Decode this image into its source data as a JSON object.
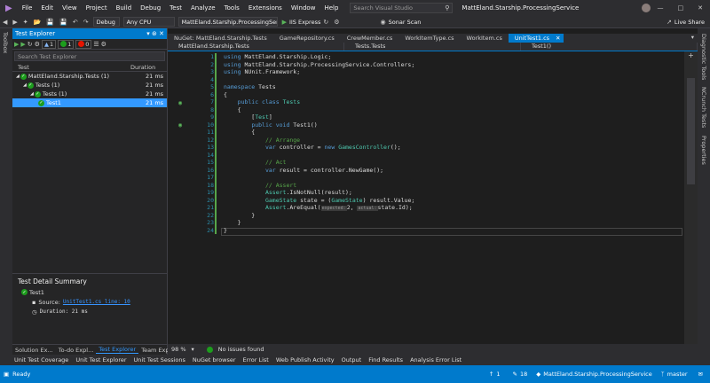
{
  "menu": [
    "File",
    "Edit",
    "View",
    "Project",
    "Build",
    "Debug",
    "Test",
    "Analyze",
    "Tools",
    "Extensions",
    "Window",
    "Help"
  ],
  "search_placeholder": "Search Visual Studio",
  "window_title": "MattEland.Starship.ProcessingService",
  "toolbar": {
    "config": "Debug",
    "platform": "Any CPU",
    "startup": "MattEland.Starship.ProcessingServi",
    "run": "IIS Express",
    "sonar": "Sonar Scan",
    "liveshare": "Live Share"
  },
  "left_strip": "Toolbox",
  "right_strip": [
    "Diagnostic Tools",
    "NCrunch Tests",
    "Properties"
  ],
  "test_explorer": {
    "title": "Test Explorer",
    "counts": {
      "total": "1",
      "passed": "1",
      "failed": "0"
    },
    "search_placeholder": "Search Test Explorer",
    "col_test": "Test",
    "col_duration": "Duration",
    "rows": [
      {
        "label": "MattEland.Starship.Tests (1)",
        "duration": "21 ms"
      },
      {
        "label": "Tests (1)",
        "duration": "21 ms"
      },
      {
        "label": "Tests (1)",
        "duration": "21 ms"
      },
      {
        "label": "Test1",
        "duration": "21 ms"
      }
    ],
    "detail": {
      "heading": "Test Detail Summary",
      "name": "Test1",
      "source_label": "Source:",
      "source_link": "UnitTest1.cs line: 10",
      "duration_label": "Duration: 21 ms"
    },
    "bottom_tabs": [
      "Solution Ex...",
      "To-do Expl...",
      "Test Explorer",
      "Team Explo..."
    ]
  },
  "doc_tabs": [
    "NuGet: MattEland.Starship.Tests",
    "GameRepository.cs",
    "CrewMember.cs",
    "WorkItemType.cs",
    "WorkItem.cs",
    "UnitTest1.cs"
  ],
  "nav": [
    "MattEland.Starship.Tests",
    "Tests.Tests",
    "Test1()"
  ],
  "code_lines": [
    {
      "n": "1",
      "parts": [
        [
          "kw",
          "using"
        ],
        [
          "pl",
          " MattEland.Starship.Logic;"
        ]
      ]
    },
    {
      "n": "2",
      "parts": [
        [
          "kw",
          "using"
        ],
        [
          "pl",
          " MattEland.Starship.ProcessingService.Controllers;"
        ]
      ]
    },
    {
      "n": "3",
      "parts": [
        [
          "kw",
          "using"
        ],
        [
          "pl",
          " NUnit.Framework;"
        ]
      ]
    },
    {
      "n": "4",
      "parts": []
    },
    {
      "n": "5",
      "parts": [
        [
          "kw",
          "namespace"
        ],
        [
          "pl",
          " Tests"
        ]
      ]
    },
    {
      "n": "6",
      "parts": [
        [
          "pl",
          "{"
        ]
      ]
    },
    {
      "n": "7",
      "parts": [
        [
          "pl",
          "    "
        ],
        [
          "kw",
          "public class"
        ],
        [
          "pl",
          " "
        ],
        [
          "ty",
          "Tests"
        ]
      ]
    },
    {
      "n": "8",
      "parts": [
        [
          "pl",
          "    {"
        ]
      ]
    },
    {
      "n": "9",
      "parts": [
        [
          "pl",
          "        ["
        ],
        [
          "ty",
          "Test"
        ],
        [
          "pl",
          "]"
        ]
      ]
    },
    {
      "n": "10",
      "parts": [
        [
          "pl",
          "        "
        ],
        [
          "kw",
          "public void"
        ],
        [
          "pl",
          " Test1()"
        ]
      ]
    },
    {
      "n": "11",
      "parts": [
        [
          "pl",
          "        {"
        ]
      ]
    },
    {
      "n": "12",
      "parts": [
        [
          "cm",
          "            // Arrange"
        ]
      ]
    },
    {
      "n": "13",
      "parts": [
        [
          "pl",
          "            "
        ],
        [
          "kw",
          "var"
        ],
        [
          "pl",
          " controller = "
        ],
        [
          "kw",
          "new"
        ],
        [
          "pl",
          " "
        ],
        [
          "ty",
          "GamesController"
        ],
        [
          "pl",
          "();"
        ]
      ]
    },
    {
      "n": "14",
      "parts": []
    },
    {
      "n": "15",
      "parts": [
        [
          "cm",
          "            // Act"
        ]
      ]
    },
    {
      "n": "16",
      "parts": [
        [
          "pl",
          "            "
        ],
        [
          "kw",
          "var"
        ],
        [
          "pl",
          " result = controller.NewGame();"
        ]
      ]
    },
    {
      "n": "17",
      "parts": []
    },
    {
      "n": "18",
      "parts": [
        [
          "cm",
          "            // Assert"
        ]
      ]
    },
    {
      "n": "19",
      "parts": [
        [
          "pl",
          "            "
        ],
        [
          "ty",
          "Assert"
        ],
        [
          "pl",
          ".IsNotNull(result);"
        ]
      ]
    },
    {
      "n": "20",
      "parts": [
        [
          "pl",
          "            "
        ],
        [
          "ty",
          "GameState"
        ],
        [
          "pl",
          " state = ("
        ],
        [
          "ty",
          "GameState"
        ],
        [
          "pl",
          ") result.Value;"
        ]
      ]
    },
    {
      "n": "21",
      "parts": [
        [
          "pl",
          "            "
        ],
        [
          "ty",
          "Assert"
        ],
        [
          "pl",
          ".AreEqual("
        ],
        [
          "hint",
          "expected:"
        ],
        [
          "pl",
          "2, "
        ],
        [
          "hint",
          "actual:"
        ],
        [
          "pl",
          "state.Id);"
        ]
      ]
    },
    {
      "n": "22",
      "parts": [
        [
          "pl",
          "        }"
        ]
      ]
    },
    {
      "n": "23",
      "parts": [
        [
          "pl",
          "    }"
        ]
      ]
    },
    {
      "n": "24",
      "parts": [
        [
          "pl",
          "}"
        ]
      ]
    }
  ],
  "editor_status": {
    "zoom": "98 %",
    "issues": "No issues found"
  },
  "tool_windows": [
    "Unit Test Coverage",
    "Unit Test Explorer",
    "Unit Test Sessions",
    "NuGet browser",
    "Error List",
    "Web Publish Activity",
    "Output",
    "Find Results",
    "Analysis Error List"
  ],
  "status": {
    "ready": "Ready",
    "up": "1",
    "pencil": "18",
    "repo": "MattEland.Starship.ProcessingService",
    "branch": "master"
  },
  "colors": {
    "accent": "#007acc",
    "pass": "#1d9d1d",
    "fail": "#e51400"
  }
}
